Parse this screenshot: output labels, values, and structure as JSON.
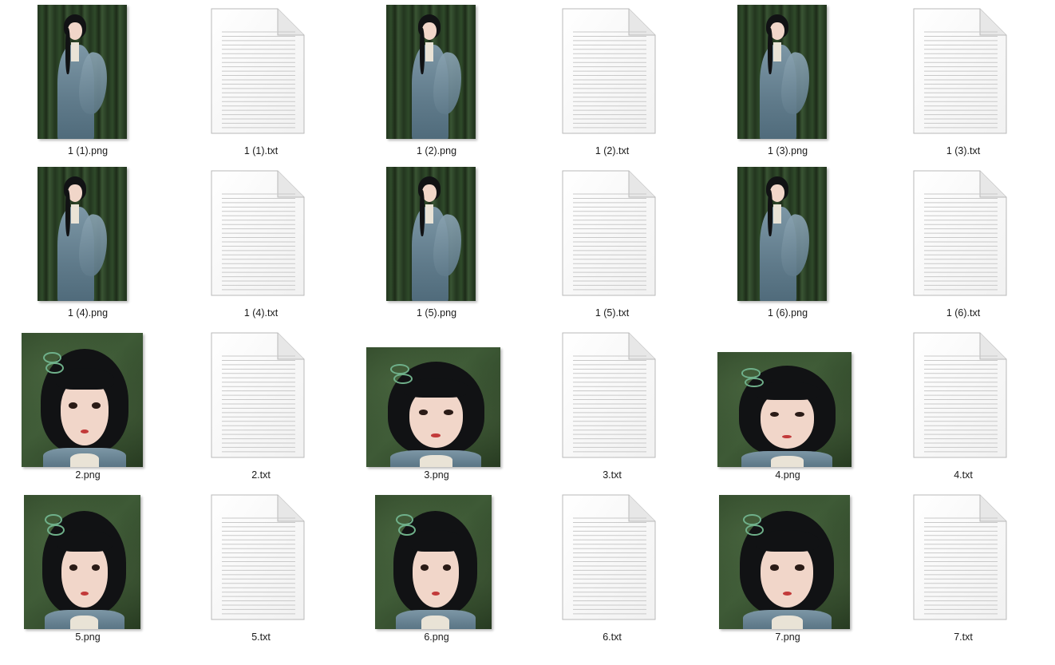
{
  "files": [
    {
      "name": "1 (1).png",
      "kind": "image",
      "style": "full",
      "icon": "image-thumbnail"
    },
    {
      "name": "1 (1).txt",
      "kind": "text",
      "icon": "text-document-icon"
    },
    {
      "name": "1 (2).png",
      "kind": "image",
      "style": "full",
      "icon": "image-thumbnail"
    },
    {
      "name": "1 (2).txt",
      "kind": "text",
      "icon": "text-document-icon"
    },
    {
      "name": "1 (3).png",
      "kind": "image",
      "style": "full",
      "icon": "image-thumbnail"
    },
    {
      "name": "1 (3).txt",
      "kind": "text",
      "icon": "text-document-icon"
    },
    {
      "name": "1 (4).png",
      "kind": "image",
      "style": "full",
      "icon": "image-thumbnail"
    },
    {
      "name": "1 (4).txt",
      "kind": "text",
      "icon": "text-document-icon"
    },
    {
      "name": "1 (5).png",
      "kind": "image",
      "style": "full",
      "icon": "image-thumbnail"
    },
    {
      "name": "1 (5).txt",
      "kind": "text",
      "icon": "text-document-icon"
    },
    {
      "name": "1 (6).png",
      "kind": "image",
      "style": "full",
      "icon": "image-thumbnail"
    },
    {
      "name": "1 (6).txt",
      "kind": "text",
      "icon": "text-document-icon"
    },
    {
      "name": "2.png",
      "kind": "image",
      "style": "portrait",
      "icon": "image-thumbnail"
    },
    {
      "name": "2.txt",
      "kind": "text",
      "icon": "text-document-icon"
    },
    {
      "name": "3.png",
      "kind": "image",
      "style": "portrait",
      "icon": "image-thumbnail"
    },
    {
      "name": "3.txt",
      "kind": "text",
      "icon": "text-document-icon"
    },
    {
      "name": "4.png",
      "kind": "image",
      "style": "portrait",
      "icon": "image-thumbnail"
    },
    {
      "name": "4.txt",
      "kind": "text",
      "icon": "text-document-icon"
    },
    {
      "name": "5.png",
      "kind": "image",
      "style": "portrait",
      "icon": "image-thumbnail"
    },
    {
      "name": "5.txt",
      "kind": "text",
      "icon": "text-document-icon"
    },
    {
      "name": "6.png",
      "kind": "image",
      "style": "portrait",
      "icon": "image-thumbnail"
    },
    {
      "name": "6.txt",
      "kind": "text",
      "icon": "text-document-icon"
    },
    {
      "name": "7.png",
      "kind": "image",
      "style": "portrait",
      "icon": "image-thumbnail"
    },
    {
      "name": "7.txt",
      "kind": "text",
      "icon": "text-document-icon"
    }
  ]
}
